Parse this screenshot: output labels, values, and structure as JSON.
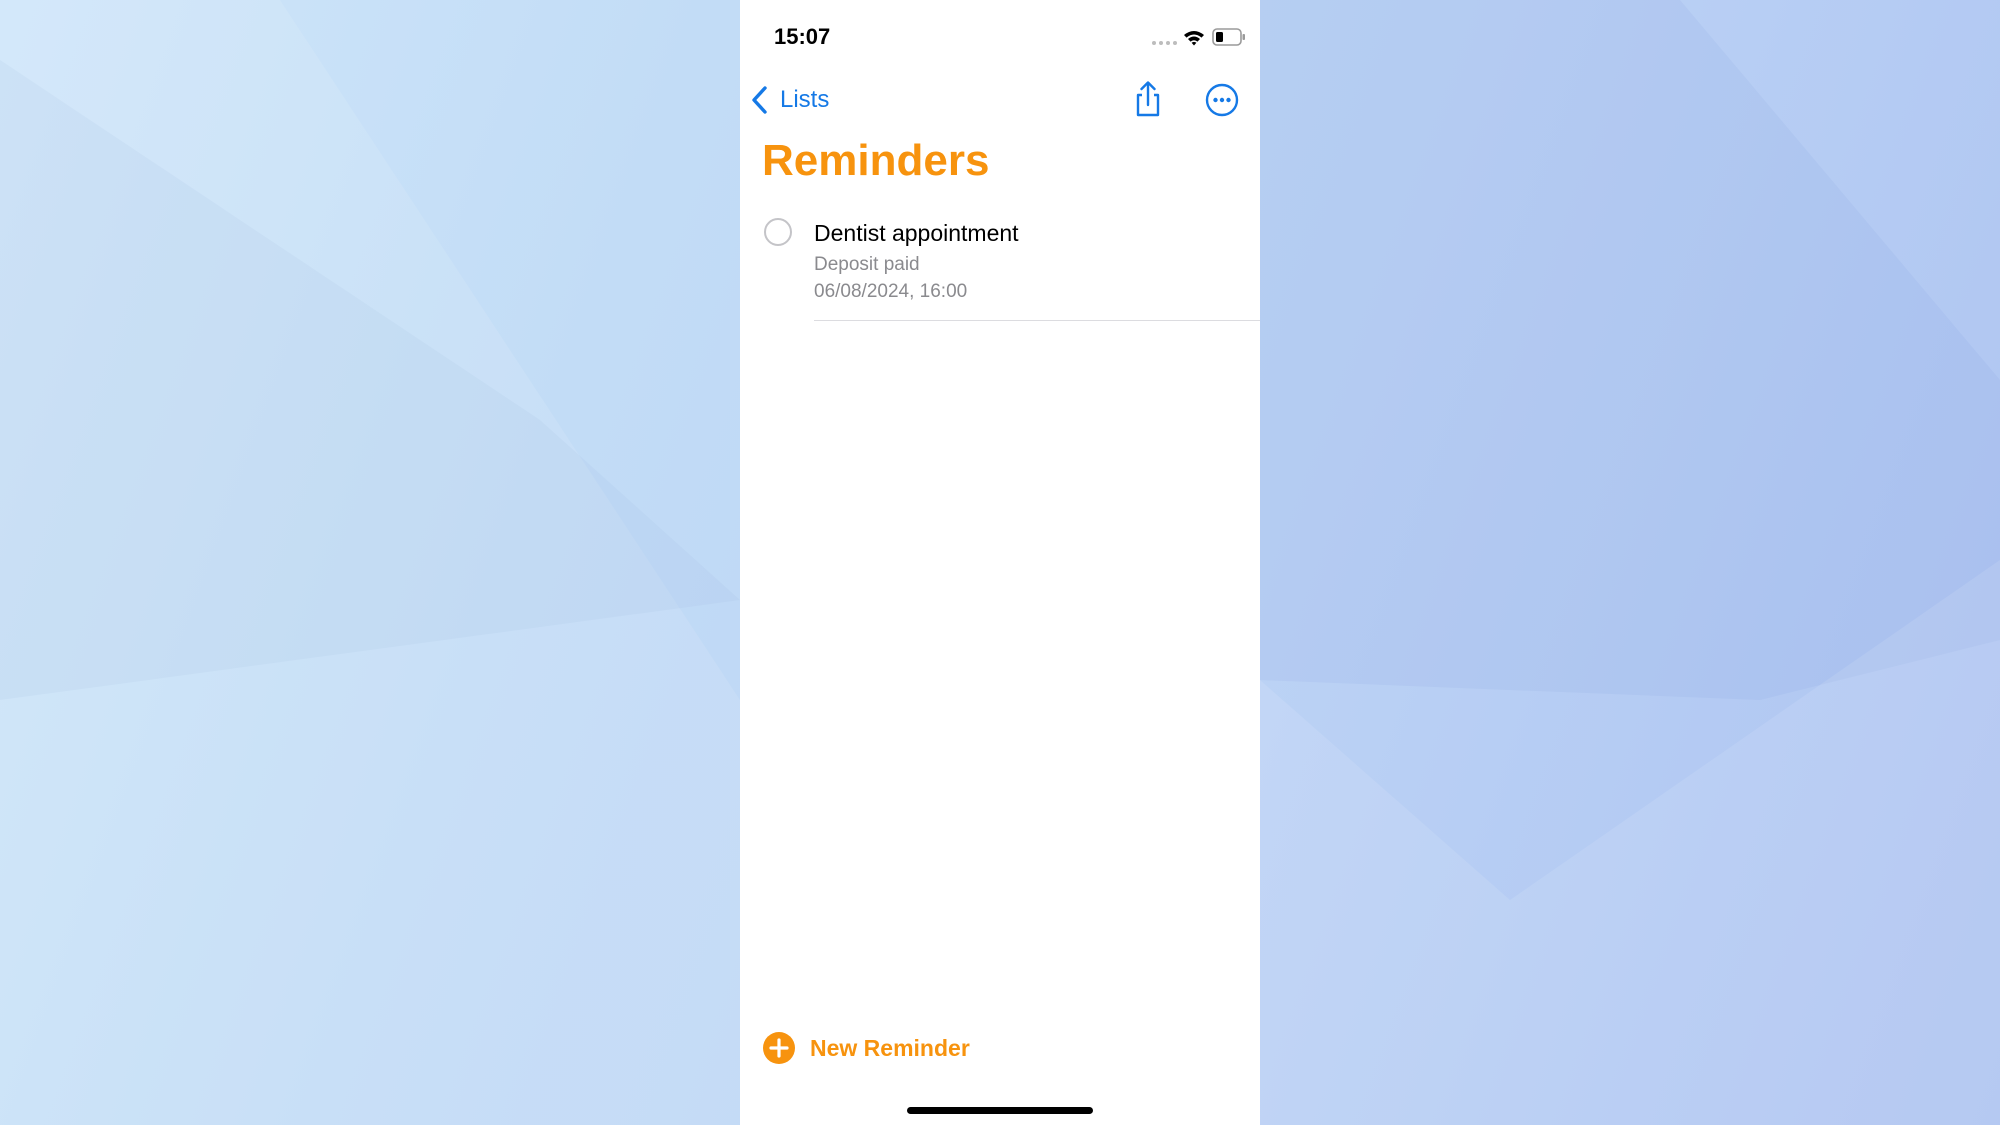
{
  "status_bar": {
    "time": "15:07"
  },
  "nav": {
    "back_label": "Lists",
    "back_icon": "chevron-left-icon",
    "share_icon": "share-icon",
    "more_icon": "ellipsis-circle-icon"
  },
  "page": {
    "title": "Reminders"
  },
  "reminders": [
    {
      "title": "Dentist appointment",
      "notes": "Deposit paid",
      "date": "06/08/2024, 16:00",
      "completed": false
    }
  ],
  "footer": {
    "new_reminder_label": "New Reminder",
    "new_reminder_icon": "plus-circle-icon"
  },
  "colors": {
    "accent_orange": "#f7930e",
    "link_blue": "#1579e6",
    "secondary_text": "#8a8a8e"
  }
}
